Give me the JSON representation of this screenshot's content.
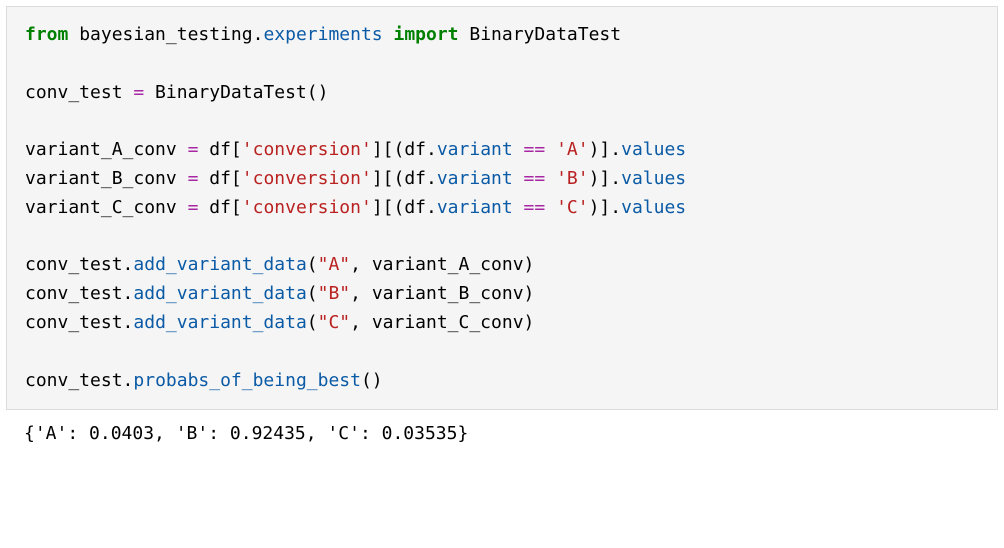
{
  "code": {
    "kw_from": "from",
    "mod1": " bayesian_testing",
    "dot1": ".",
    "mod2": "experiments",
    "sp1": " ",
    "kw_import": "import",
    "imp_rest": " BinaryDataTest",
    "l3_a": "conv_test ",
    "l3_eq": "=",
    "l3_b": " BinaryDataTest()",
    "vA_a": "variant_A_conv ",
    "vA_eq": "=",
    "vA_b": " df[",
    "vA_s1": "'conversion'",
    "vA_c": "][(df",
    "vA_dot": ".",
    "vA_var": "variant",
    "vA_sp": " ",
    "vA_eqeq": "==",
    "vA_sp2": " ",
    "vA_s2": "'A'",
    "vA_d": ")]",
    "vA_dot2": ".",
    "vA_val": "values",
    "vB_a": "variant_B_conv ",
    "vB_eq": "=",
    "vB_b": " df[",
    "vB_s1": "'conversion'",
    "vB_c": "][(df",
    "vB_dot": ".",
    "vB_var": "variant",
    "vB_sp": " ",
    "vB_eqeq": "==",
    "vB_sp2": " ",
    "vB_s2": "'B'",
    "vB_d": ")]",
    "vB_dot2": ".",
    "vB_val": "values",
    "vC_a": "variant_C_conv ",
    "vC_eq": "=",
    "vC_b": " df[",
    "vC_s1": "'conversion'",
    "vC_c": "][(df",
    "vC_dot": ".",
    "vC_var": "variant",
    "vC_sp": " ",
    "vC_eqeq": "==",
    "vC_sp2": " ",
    "vC_s2": "'C'",
    "vC_d": ")]",
    "vC_dot2": ".",
    "vC_val": "values",
    "addA_a": "conv_test",
    "addA_dot": ".",
    "addA_fn": "add_variant_data",
    "addA_b": "(",
    "addA_s": "\"A\"",
    "addA_c": ", variant_A_conv)",
    "addB_a": "conv_test",
    "addB_dot": ".",
    "addB_fn": "add_variant_data",
    "addB_b": "(",
    "addB_s": "\"B\"",
    "addB_c": ", variant_B_conv)",
    "addC_a": "conv_test",
    "addC_dot": ".",
    "addC_fn": "add_variant_data",
    "addC_b": "(",
    "addC_s": "\"C\"",
    "addC_c": ", variant_C_conv)",
    "last_a": "conv_test",
    "last_dot": ".",
    "last_fn": "probabs_of_being_best",
    "last_b": "()"
  },
  "output": {
    "text": "{'A': 0.0403, 'B': 0.92435, 'C': 0.03535}"
  }
}
